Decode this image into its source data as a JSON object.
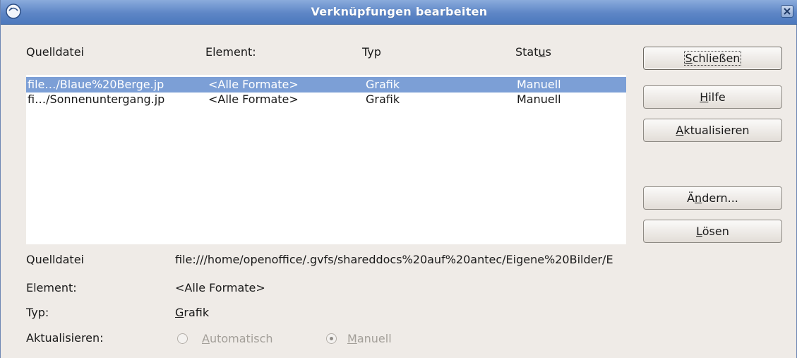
{
  "window": {
    "title": "Verknüpfungen bearbeiten"
  },
  "list": {
    "headers": {
      "source_file": "Quelldatei",
      "element": "Element:",
      "type": "Typ",
      "status_pre": "Stat",
      "status_u": "u",
      "status_post": "s"
    },
    "rows": [
      {
        "source": "file…/Blaue%20Berge.jp",
        "element": "<Alle Formate>",
        "type": "Grafik",
        "status": "Manuell",
        "selected": true
      },
      {
        "source": "fi…/Sonnenuntergang.jp",
        "element": "<Alle Formate>",
        "type": "Grafik",
        "status": "Manuell",
        "selected": false
      }
    ]
  },
  "buttons": {
    "close": {
      "pre": "",
      "u": "S",
      "post": "chließen"
    },
    "help": {
      "pre": "",
      "u": "H",
      "post": "ilfe"
    },
    "update": {
      "pre": "",
      "u": "A",
      "post": "ktualisieren"
    },
    "modify": {
      "pre": "Ä",
      "u": "n",
      "post": "dern..."
    },
    "break": {
      "pre": "",
      "u": "L",
      "post": "ösen"
    }
  },
  "details": {
    "source_label": "Quelldatei",
    "source_value": "file:///home/openoffice/.gvfs/shareddocs%20auf%20antec/Eigene%20Bilder/E",
    "element_label": "Element:",
    "element_value": "<Alle Formate>",
    "type_label": "Typ:",
    "type_value_u": "G",
    "type_value_rest": "rafik",
    "update_label": "Aktualisieren:",
    "auto_u": "A",
    "auto_rest": "utomatisch",
    "manual_u": "M",
    "manual_rest": "anuell"
  },
  "colors": {
    "titlebar": "#5d86c6",
    "selection": "#7c9fd6",
    "dialog_bg": "#efebe7"
  }
}
